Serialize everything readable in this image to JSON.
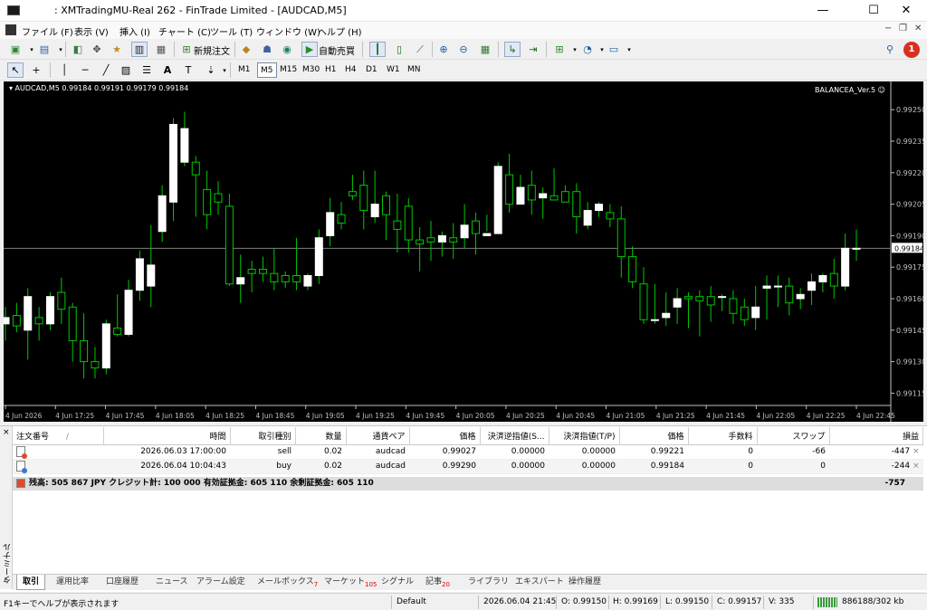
{
  "window": {
    "title": ": XMTradingMU-Real 262 - FinTrade Limited - [AUDCAD,M5]",
    "minimize": "—",
    "maximize": "☐",
    "close": "✕"
  },
  "menu": [
    "ファイル (F)",
    "表示 (V)",
    "挿入 (I)",
    "チャート (C)",
    "ツール (T)",
    "ウィンドウ (W)",
    "ヘルプ (H)"
  ],
  "toolbar": {
    "new_order": "新規注文",
    "autotrade": "自動売買",
    "timeframes": [
      "M1",
      "M5",
      "M15",
      "M30",
      "H1",
      "H4",
      "D1",
      "W1",
      "MN"
    ],
    "active_timeframe": "M5",
    "notification_count": "1"
  },
  "chart": {
    "symbol_info": "AUDCAD,M5  0.99184 0.99191 0.99179 0.99184",
    "ea_label": "BALANCEA_Ver.5",
    "current_price_label": "0.99184",
    "colors": {
      "background": "#000000",
      "bull_body": "#ffffff",
      "wick": "#00c800",
      "bid_line": "#7f7f7f",
      "axis": "#c0c0c0"
    }
  },
  "chart_data": {
    "type": "candlestick",
    "symbol": "AUDCAD",
    "timeframe": "M5",
    "ylim": [
      0.9911,
      0.9926
    ],
    "y_ticks": [
      "0.99250",
      "0.99235",
      "0.99220",
      "0.99205",
      "0.99190",
      "0.99175",
      "0.99160",
      "0.99145",
      "0.99130",
      "0.99115"
    ],
    "x_ticks": [
      "4 Jun 2026",
      "4 Jun 17:25",
      "4 Jun 17:45",
      "4 Jun 18:05",
      "4 Jun 18:25",
      "4 Jun 18:45",
      "4 Jun 19:05",
      "4 Jun 19:25",
      "4 Jun 19:45",
      "4 Jun 20:05",
      "4 Jun 20:25",
      "4 Jun 20:45",
      "4 Jun 21:05",
      "4 Jun 21:25",
      "4 Jun 21:45",
      "4 Jun 22:05",
      "4 Jun 22:25",
      "4 Jun 22:45"
    ],
    "bid": 0.99184,
    "candles": [
      [
        0.99148,
        0.99156,
        0.9914,
        0.99151
      ],
      [
        0.99152,
        0.99158,
        0.99144,
        0.99147
      ],
      [
        0.99145,
        0.99165,
        0.99131,
        0.99161
      ],
      [
        0.99151,
        0.99156,
        0.9914,
        0.99148
      ],
      [
        0.99148,
        0.99163,
        0.99145,
        0.99161
      ],
      [
        0.99163,
        0.9917,
        0.99148,
        0.99155
      ],
      [
        0.99156,
        0.99158,
        0.9913,
        0.9914
      ],
      [
        0.9914,
        0.99153,
        0.99122,
        0.9913
      ],
      [
        0.9913,
        0.99137,
        0.99122,
        0.99127
      ],
      [
        0.99127,
        0.9915,
        0.99124,
        0.99148
      ],
      [
        0.99146,
        0.99162,
        0.99142,
        0.99143
      ],
      [
        0.99143,
        0.99169,
        0.99142,
        0.99164
      ],
      [
        0.99164,
        0.99183,
        0.99159,
        0.99179
      ],
      [
        0.99166,
        0.99195,
        0.99156,
        0.99176
      ],
      [
        0.99192,
        0.99214,
        0.99187,
        0.99209
      ],
      [
        0.99206,
        0.99246,
        0.99197,
        0.99243
      ],
      [
        0.99225,
        0.99249,
        0.99223,
        0.99241
      ],
      [
        0.99225,
        0.99228,
        0.99199,
        0.99219
      ],
      [
        0.99212,
        0.99221,
        0.99193,
        0.992
      ],
      [
        0.9921,
        0.99216,
        0.992,
        0.99206
      ],
      [
        0.99204,
        0.9921,
        0.99166,
        0.99167
      ],
      [
        0.99167,
        0.99181,
        0.99158,
        0.9917
      ],
      [
        0.99174,
        0.99178,
        0.99163,
        0.99172
      ],
      [
        0.99174,
        0.9918,
        0.99168,
        0.99172
      ],
      [
        0.99172,
        0.99184,
        0.99164,
        0.99168
      ],
      [
        0.99171,
        0.99173,
        0.99165,
        0.99168
      ],
      [
        0.99171,
        0.99189,
        0.99164,
        0.99168
      ],
      [
        0.99166,
        0.99172,
        0.99164,
        0.99171
      ],
      [
        0.99171,
        0.99193,
        0.99167,
        0.99189
      ],
      [
        0.9919,
        0.99208,
        0.99185,
        0.99201
      ],
      [
        0.992,
        0.99206,
        0.99193,
        0.99196
      ],
      [
        0.99211,
        0.99219,
        0.99207,
        0.99209
      ],
      [
        0.99214,
        0.99221,
        0.99193,
        0.99202
      ],
      [
        0.99199,
        0.99221,
        0.99196,
        0.99205
      ],
      [
        0.99209,
        0.99211,
        0.99188,
        0.992
      ],
      [
        0.99197,
        0.9921,
        0.99182,
        0.99193
      ],
      [
        0.99204,
        0.99208,
        0.99182,
        0.99188
      ],
      [
        0.99188,
        0.99194,
        0.99173,
        0.99186
      ],
      [
        0.99189,
        0.99197,
        0.99178,
        0.99187
      ],
      [
        0.99187,
        0.99192,
        0.9918,
        0.9919
      ],
      [
        0.99189,
        0.99196,
        0.99179,
        0.99187
      ],
      [
        0.99189,
        0.99205,
        0.99184,
        0.99195
      ],
      [
        0.99197,
        0.99201,
        0.99181,
        0.99191
      ],
      [
        0.9919,
        0.992,
        0.99192,
        0.99191
      ],
      [
        0.99191,
        0.99225,
        0.99194,
        0.99223
      ],
      [
        0.99219,
        0.99229,
        0.99201,
        0.99205
      ],
      [
        0.99205,
        0.99219,
        0.99209,
        0.99213
      ],
      [
        0.99214,
        0.99221,
        0.992,
        0.99207
      ],
      [
        0.99208,
        0.99213,
        0.99198,
        0.9921
      ],
      [
        0.99209,
        0.99222,
        0.99207,
        0.99207
      ],
      [
        0.99211,
        0.99214,
        0.99208,
        0.99206
      ],
      [
        0.99211,
        0.99215,
        0.99191,
        0.99199
      ],
      [
        0.99195,
        0.99206,
        0.99193,
        0.99202
      ],
      [
        0.99202,
        0.99206,
        0.99199,
        0.99205
      ],
      [
        0.99201,
        0.99205,
        0.99194,
        0.99198
      ],
      [
        0.99198,
        0.99204,
        0.9917,
        0.9918
      ],
      [
        0.9918,
        0.99185,
        0.99165,
        0.99168
      ],
      [
        0.99167,
        0.99175,
        0.99148,
        0.9915
      ],
      [
        0.9915,
        0.99167,
        0.99148,
        0.9915
      ],
      [
        0.99151,
        0.99163,
        0.99147,
        0.99153
      ],
      [
        0.99156,
        0.99165,
        0.99148,
        0.9916
      ],
      [
        0.99161,
        0.99163,
        0.99146,
        0.9916
      ],
      [
        0.99161,
        0.99164,
        0.99142,
        0.99159
      ],
      [
        0.99161,
        0.99166,
        0.99149,
        0.99157
      ],
      [
        0.99161,
        0.99162,
        0.99154,
        0.99161
      ],
      [
        0.9916,
        0.99164,
        0.99148,
        0.99153
      ],
      [
        0.99156,
        0.9916,
        0.99147,
        0.9915
      ],
      [
        0.99151,
        0.99166,
        0.99145,
        0.99156
      ],
      [
        0.99165,
        0.99171,
        0.9915,
        0.99166
      ],
      [
        0.99166,
        0.99171,
        0.99156,
        0.99166
      ],
      [
        0.99166,
        0.9917,
        0.99152,
        0.99158
      ],
      [
        0.9916,
        0.99165,
        0.99155,
        0.99162
      ],
      [
        0.99164,
        0.99172,
        0.99157,
        0.99168
      ],
      [
        0.99168,
        0.99172,
        0.99163,
        0.99171
      ],
      [
        0.99172,
        0.99179,
        0.9916,
        0.99166
      ],
      [
        0.99166,
        0.99191,
        0.99164,
        0.99184
      ],
      [
        0.99184,
        0.99193,
        0.99178,
        0.99184
      ]
    ]
  },
  "terminal": {
    "side_label": "ターミナル",
    "close_label": "×",
    "columns": [
      "注文番号",
      "/",
      "時間",
      "取引種別",
      "数量",
      "通貨ペア",
      "価格",
      "決済逆指値(S...",
      "決済指値(T/P)",
      "価格",
      "手数料",
      "スワップ",
      "損益"
    ],
    "orders": [
      {
        "type": "sell",
        "time": "2026.06.03 17:00:00",
        "side": "sell",
        "volume": "0.02",
        "symbol": "audcad",
        "open_price": "0.99027",
        "sl": "0.00000",
        "tp": "0.00000",
        "price": "0.99221",
        "commission": "0",
        "swap": "-66",
        "profit": "-447"
      },
      {
        "type": "buy",
        "time": "2026.06.04 10:04:43",
        "side": "buy",
        "volume": "0.02",
        "symbol": "audcad",
        "open_price": "0.99290",
        "sl": "0.00000",
        "tp": "0.00000",
        "price": "0.99184",
        "commission": "0",
        "swap": "0",
        "profit": "-244"
      }
    ],
    "row_close": "×",
    "balance_text": "残高: 505 867 JPY  クレジット計: 100 000  有効証拠金: 605 110  余剰証拠金: 605 110",
    "total_profit": "-757",
    "tabs": [
      {
        "label": "取引",
        "badge": ""
      },
      {
        "label": "運用比率",
        "badge": ""
      },
      {
        "label": "口座履歴",
        "badge": ""
      },
      {
        "label": "ニュース",
        "badge": ""
      },
      {
        "label": "アラーム設定",
        "badge": ""
      },
      {
        "label": "メールボックス",
        "badge": "7"
      },
      {
        "label": "マーケット",
        "badge": "105"
      },
      {
        "label": "シグナル",
        "badge": ""
      },
      {
        "label": "記事",
        "badge": "20"
      },
      {
        "label": "ライブラリ",
        "badge": ""
      },
      {
        "label": "エキスパート",
        "badge": ""
      },
      {
        "label": "操作履歴",
        "badge": ""
      }
    ]
  },
  "status": {
    "help": "F1キーでヘルプが表示されます",
    "profile": "Default",
    "datetime": "2026.06.04 21:45",
    "open": "O: 0.99150",
    "high": "H: 0.99169",
    "low": "L: 0.99150",
    "close": "C: 0.99157",
    "volume": "V: 335",
    "traffic": "886188/302 kb"
  }
}
